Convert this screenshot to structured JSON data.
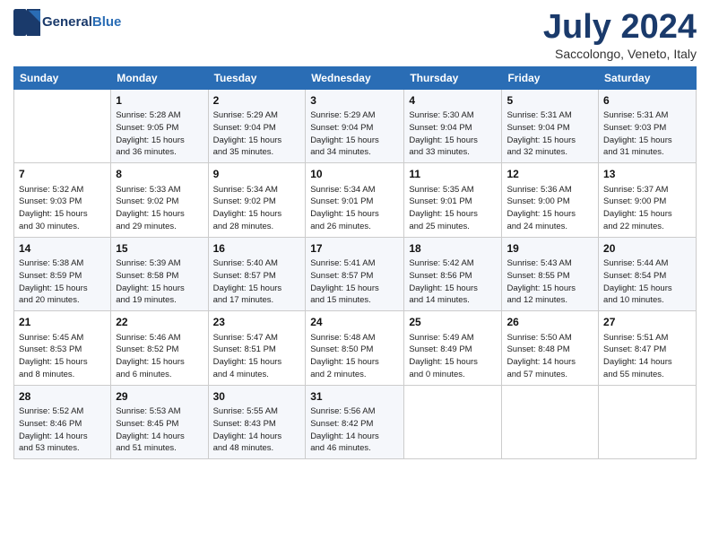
{
  "header": {
    "logo_line1": "General",
    "logo_line2": "Blue",
    "month_title": "July 2024",
    "location": "Saccolongo, Veneto, Italy"
  },
  "weekdays": [
    "Sunday",
    "Monday",
    "Tuesday",
    "Wednesday",
    "Thursday",
    "Friday",
    "Saturday"
  ],
  "weeks": [
    [
      {
        "day": "",
        "content": ""
      },
      {
        "day": "1",
        "content": "Sunrise: 5:28 AM\nSunset: 9:05 PM\nDaylight: 15 hours\nand 36 minutes."
      },
      {
        "day": "2",
        "content": "Sunrise: 5:29 AM\nSunset: 9:04 PM\nDaylight: 15 hours\nand 35 minutes."
      },
      {
        "day": "3",
        "content": "Sunrise: 5:29 AM\nSunset: 9:04 PM\nDaylight: 15 hours\nand 34 minutes."
      },
      {
        "day": "4",
        "content": "Sunrise: 5:30 AM\nSunset: 9:04 PM\nDaylight: 15 hours\nand 33 minutes."
      },
      {
        "day": "5",
        "content": "Sunrise: 5:31 AM\nSunset: 9:04 PM\nDaylight: 15 hours\nand 32 minutes."
      },
      {
        "day": "6",
        "content": "Sunrise: 5:31 AM\nSunset: 9:03 PM\nDaylight: 15 hours\nand 31 minutes."
      }
    ],
    [
      {
        "day": "7",
        "content": "Sunrise: 5:32 AM\nSunset: 9:03 PM\nDaylight: 15 hours\nand 30 minutes."
      },
      {
        "day": "8",
        "content": "Sunrise: 5:33 AM\nSunset: 9:02 PM\nDaylight: 15 hours\nand 29 minutes."
      },
      {
        "day": "9",
        "content": "Sunrise: 5:34 AM\nSunset: 9:02 PM\nDaylight: 15 hours\nand 28 minutes."
      },
      {
        "day": "10",
        "content": "Sunrise: 5:34 AM\nSunset: 9:01 PM\nDaylight: 15 hours\nand 26 minutes."
      },
      {
        "day": "11",
        "content": "Sunrise: 5:35 AM\nSunset: 9:01 PM\nDaylight: 15 hours\nand 25 minutes."
      },
      {
        "day": "12",
        "content": "Sunrise: 5:36 AM\nSunset: 9:00 PM\nDaylight: 15 hours\nand 24 minutes."
      },
      {
        "day": "13",
        "content": "Sunrise: 5:37 AM\nSunset: 9:00 PM\nDaylight: 15 hours\nand 22 minutes."
      }
    ],
    [
      {
        "day": "14",
        "content": "Sunrise: 5:38 AM\nSunset: 8:59 PM\nDaylight: 15 hours\nand 20 minutes."
      },
      {
        "day": "15",
        "content": "Sunrise: 5:39 AM\nSunset: 8:58 PM\nDaylight: 15 hours\nand 19 minutes."
      },
      {
        "day": "16",
        "content": "Sunrise: 5:40 AM\nSunset: 8:57 PM\nDaylight: 15 hours\nand 17 minutes."
      },
      {
        "day": "17",
        "content": "Sunrise: 5:41 AM\nSunset: 8:57 PM\nDaylight: 15 hours\nand 15 minutes."
      },
      {
        "day": "18",
        "content": "Sunrise: 5:42 AM\nSunset: 8:56 PM\nDaylight: 15 hours\nand 14 minutes."
      },
      {
        "day": "19",
        "content": "Sunrise: 5:43 AM\nSunset: 8:55 PM\nDaylight: 15 hours\nand 12 minutes."
      },
      {
        "day": "20",
        "content": "Sunrise: 5:44 AM\nSunset: 8:54 PM\nDaylight: 15 hours\nand 10 minutes."
      }
    ],
    [
      {
        "day": "21",
        "content": "Sunrise: 5:45 AM\nSunset: 8:53 PM\nDaylight: 15 hours\nand 8 minutes."
      },
      {
        "day": "22",
        "content": "Sunrise: 5:46 AM\nSunset: 8:52 PM\nDaylight: 15 hours\nand 6 minutes."
      },
      {
        "day": "23",
        "content": "Sunrise: 5:47 AM\nSunset: 8:51 PM\nDaylight: 15 hours\nand 4 minutes."
      },
      {
        "day": "24",
        "content": "Sunrise: 5:48 AM\nSunset: 8:50 PM\nDaylight: 15 hours\nand 2 minutes."
      },
      {
        "day": "25",
        "content": "Sunrise: 5:49 AM\nSunset: 8:49 PM\nDaylight: 15 hours\nand 0 minutes."
      },
      {
        "day": "26",
        "content": "Sunrise: 5:50 AM\nSunset: 8:48 PM\nDaylight: 14 hours\nand 57 minutes."
      },
      {
        "day": "27",
        "content": "Sunrise: 5:51 AM\nSunset: 8:47 PM\nDaylight: 14 hours\nand 55 minutes."
      }
    ],
    [
      {
        "day": "28",
        "content": "Sunrise: 5:52 AM\nSunset: 8:46 PM\nDaylight: 14 hours\nand 53 minutes."
      },
      {
        "day": "29",
        "content": "Sunrise: 5:53 AM\nSunset: 8:45 PM\nDaylight: 14 hours\nand 51 minutes."
      },
      {
        "day": "30",
        "content": "Sunrise: 5:55 AM\nSunset: 8:43 PM\nDaylight: 14 hours\nand 48 minutes."
      },
      {
        "day": "31",
        "content": "Sunrise: 5:56 AM\nSunset: 8:42 PM\nDaylight: 14 hours\nand 46 minutes."
      },
      {
        "day": "",
        "content": ""
      },
      {
        "day": "",
        "content": ""
      },
      {
        "day": "",
        "content": ""
      }
    ]
  ]
}
